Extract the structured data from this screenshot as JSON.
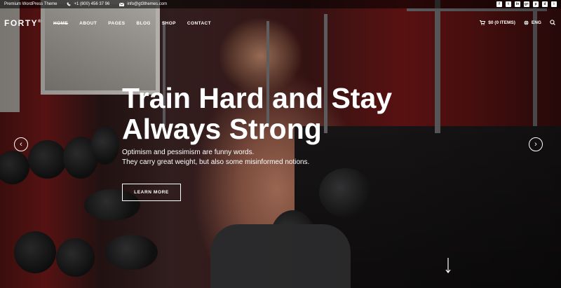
{
  "topbar": {
    "tagline": "Premium WordPress Theme",
    "phone": "+1 (800) 456 37 96",
    "email": "info@gt3themes.com",
    "social": [
      "f",
      "t",
      "in",
      "g+",
      "p",
      "d",
      "i"
    ]
  },
  "nav": {
    "logo": "FORTY",
    "logo_mark": "®",
    "items": [
      "HOME",
      "ABOUT",
      "PAGES",
      "BLOG",
      "SHOP",
      "CONTACT"
    ],
    "cart": "$0 (0 ITEMS)",
    "language": "ENG"
  },
  "hero": {
    "headline_line1": "Train Hard and Stay",
    "headline_line2": "Always Strong",
    "sub_line1": "Optimism and pessimism are funny words.",
    "sub_line2": "They carry great weight, but also some misinformed notions.",
    "cta": "LEARN MORE"
  },
  "icons": {
    "prev": "‹",
    "next": "›"
  }
}
